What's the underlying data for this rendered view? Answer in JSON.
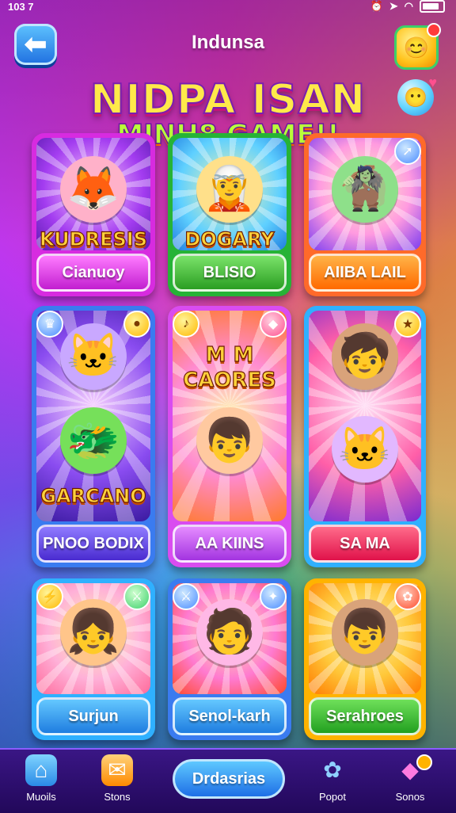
{
  "status": {
    "time": "103 7"
  },
  "header": {
    "title": "Indunsa",
    "back_icon": "arrow-left-icon",
    "profile_icon": "smiley-icon"
  },
  "title": {
    "line1": "NIDPA ISAN",
    "line2": "MINH8 GAME!!"
  },
  "cards": [
    {
      "art_text": "KUDRESIS",
      "label": "Cianuoy",
      "corner_icon": ""
    },
    {
      "art_text": "DOGARY",
      "label": "BLISIO",
      "corner_icon": ""
    },
    {
      "art_text": "",
      "label": "AIIBA LAIL",
      "corner_icon": "arrow-icon"
    },
    {
      "art_text": "GARCANO",
      "label": "PNOO BODIX",
      "corner_icon": "crown-icon"
    },
    {
      "art_text": "M M CAORES",
      "label": "AA KIINS",
      "corner_icon": "music-icon"
    },
    {
      "art_text": "",
      "label": "SA MA",
      "corner_icon": "star-icon"
    },
    {
      "art_text": "",
      "label": "Surjun",
      "corner_icon": "bolt-icon"
    },
    {
      "art_text": "",
      "label": "Senol-karh",
      "corner_icon": "sword-icon"
    },
    {
      "art_text": "",
      "label": "Serahroes",
      "corner_icon": "gift-icon"
    }
  ],
  "nav": {
    "items": [
      {
        "label": "Muoils",
        "icon": "home-icon"
      },
      {
        "label": "Stons",
        "icon": "mail-icon"
      },
      {
        "label": "Popot",
        "icon": "flower-icon"
      },
      {
        "label": "Sonos",
        "icon": "gem-icon"
      }
    ],
    "center_label": "Drdasrias"
  },
  "colors": {
    "accent": "#1e6fe6",
    "title": "#ffe94a"
  }
}
